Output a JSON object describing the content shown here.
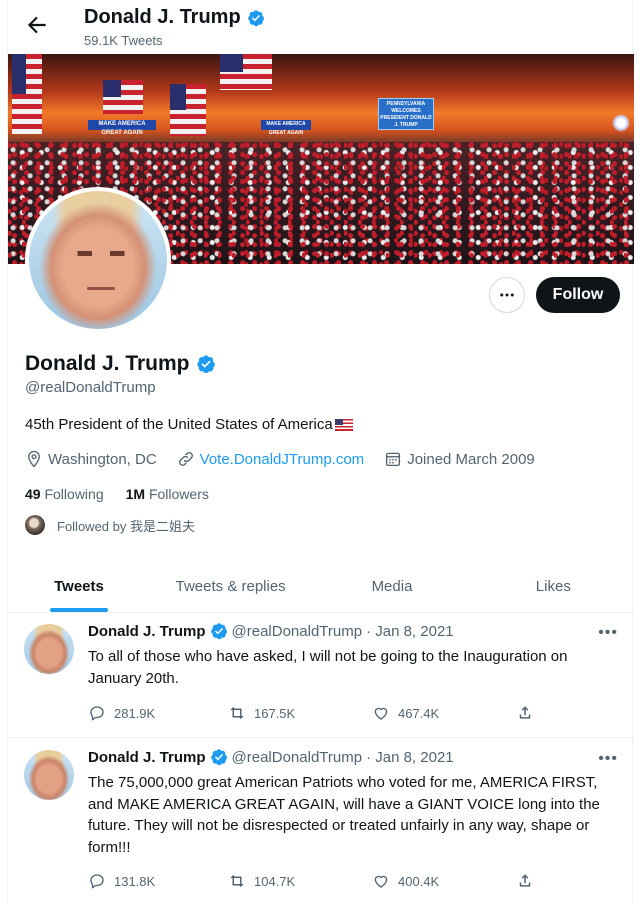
{
  "header": {
    "name": "Donald J. Trump",
    "tweet_count": "59.1K Tweets"
  },
  "banner": {
    "sign_left": "MAKE AMERICA GREAT AGAIN",
    "sign_mid": "MAKE AMERICA GREAT AGAIN",
    "sign_big": "PENNSYLVANIA WELCOMES PRESIDENT DONALD J. TRUMP"
  },
  "profile": {
    "name": "Donald J. Trump",
    "handle": "@realDonaldTrump",
    "bio": "45th President of the United States of America",
    "location": "Washington, DC",
    "website": "Vote.DonaldJTrump.com",
    "joined": "Joined March 2009",
    "following_count": "49",
    "following_label": "Following",
    "followers_count": "1M",
    "followers_label": "Followers",
    "followed_by": "Followed by 我是二姐夫",
    "follow_button": "Follow",
    "more_button": "•••"
  },
  "tabs": [
    "Tweets",
    "Tweets & replies",
    "Media",
    "Likes"
  ],
  "tweets": [
    {
      "name": "Donald J. Trump",
      "handle": "@realDonaldTrump",
      "date": "· Jan 8, 2021",
      "text": "To all of those who have asked, I will not be going to the Inauguration on January 20th.",
      "replies": "281.9K",
      "retweets": "167.5K",
      "likes": "467.4K"
    },
    {
      "name": "Donald J. Trump",
      "handle": "@realDonaldTrump",
      "date": "· Jan 8, 2021",
      "text": "The 75,000,000 great American Patriots who voted for me, AMERICA FIRST, and MAKE AMERICA GREAT AGAIN, will have a GIANT VOICE long into the future. They will not be disrespected or treated unfairly in any way, shape or form!!!",
      "replies": "131.8K",
      "retweets": "104.7K",
      "likes": "400.4K"
    }
  ],
  "icons": {
    "back": "arrow-left-icon",
    "verified": "verified-badge-icon",
    "location": "location-pin-icon",
    "link": "link-icon",
    "calendar": "calendar-icon",
    "reply": "reply-icon",
    "retweet": "retweet-icon",
    "like": "heart-icon",
    "share": "share-icon"
  },
  "colors": {
    "accent": "#1d9bf0",
    "text": "#0f1419",
    "secondary": "#536471",
    "follow_button_bg": "#0f1419"
  }
}
